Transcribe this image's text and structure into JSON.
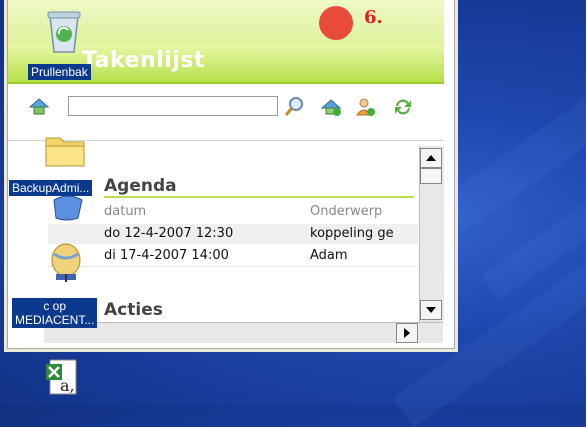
{
  "desktop": {
    "icons": [
      {
        "label": "Prullenbak"
      },
      {
        "label": "BackupAdmi..."
      },
      {
        "label_line1": "c op",
        "label_line2": "MEDIACENT..."
      },
      {
        "label": ""
      }
    ]
  },
  "widget": {
    "title": "Takenlijst",
    "step_number": "6.",
    "search": {
      "value": "",
      "placeholder": ""
    },
    "sections": {
      "agenda": {
        "title": "Agenda",
        "columns": [
          "datum",
          "Onderwerp"
        ],
        "rows": [
          {
            "datum": "do 12-4-2007 12:30",
            "onderwerp": "koppeling ge"
          },
          {
            "datum": "di 17-4-2007 14:00",
            "onderwerp": "Adam"
          }
        ]
      },
      "acties": {
        "title": "Acties"
      }
    }
  },
  "colors": {
    "desktop_bg": "#1f48ae",
    "title_green": "#b7e04a",
    "step_red": "#e21f1f",
    "dot_red": "#e84b3b",
    "label_bg": "#0b3a8c"
  }
}
